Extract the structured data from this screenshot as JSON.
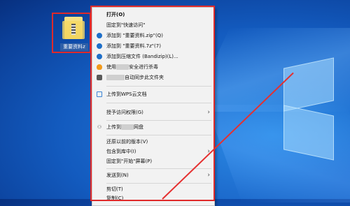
{
  "desktop": {
    "file_label": "重要资料z"
  },
  "menu": {
    "items": [
      {
        "label": "打开(O)",
        "bold": true
      },
      {
        "label": "固定到\"快速访问\""
      },
      {
        "label": "添加到 \"重要资料.zip\"(Q)",
        "icon": "bandizip-icon"
      },
      {
        "label": "添加到 \"重要资料.7z\"(7)",
        "icon": "bandizip-icon"
      },
      {
        "label": "添加到压缩文件 (Bandizip)(L)...",
        "icon": "bandizip-icon"
      },
      {
        "label_pre": "使用",
        "label_post": "安全进行杀毒",
        "icon": "antivirus-icon"
      },
      {
        "label_pre": "",
        "label_post": "自动同步此文件夹",
        "icon": "sync-icon"
      },
      {
        "label": "上传到WPS云文档",
        "icon": "wps-cloud-icon"
      },
      {
        "label": "授予访问权限(G)",
        "submenu": true
      },
      {
        "label_pre": "上传到",
        "label_post": "网盘",
        "icon": "share-icon"
      },
      {
        "label": "还原以前的版本(V)"
      },
      {
        "label": "包含到库中(I)",
        "submenu": true
      },
      {
        "label": "固定到\"开始\"屏幕(P)"
      },
      {
        "label": "发送到(N)",
        "submenu": true
      },
      {
        "label": "剪切(T)"
      },
      {
        "label": "复制(C)"
      }
    ]
  },
  "colors": {
    "annotation_red": "#e02a2a",
    "desktop_blue": "#135bbf"
  }
}
